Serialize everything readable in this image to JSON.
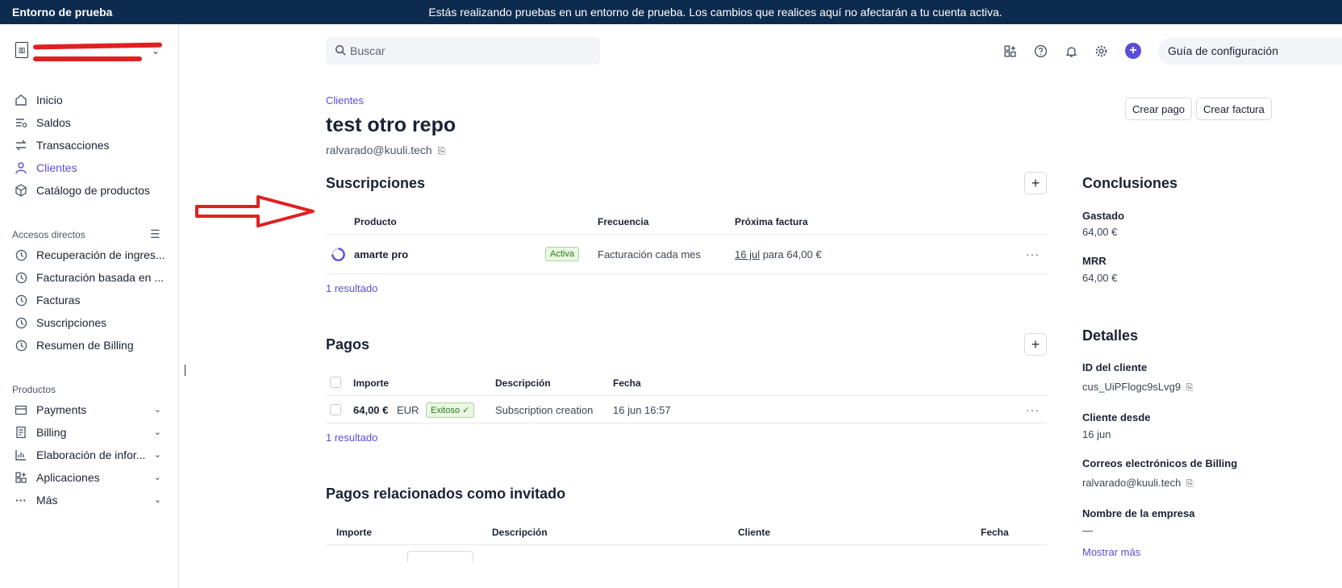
{
  "banner": {
    "env": "Entorno de prueba",
    "message": "Estás realizando pruebas en un entorno de prueba. Los cambios que realices aquí no afectarán a tu cuenta activa."
  },
  "sidebar": {
    "main": [
      {
        "label": "Inicio",
        "icon": "home-icon"
      },
      {
        "label": "Saldos",
        "icon": "balances-icon"
      },
      {
        "label": "Transacciones",
        "icon": "transactions-icon"
      },
      {
        "label": "Clientes",
        "icon": "customer-icon",
        "active": true
      },
      {
        "label": "Catálogo de productos",
        "icon": "box-icon"
      }
    ],
    "shortcuts_title": "Accesos directos",
    "shortcuts": [
      {
        "label": "Recuperación de ingres..."
      },
      {
        "label": "Facturación basada en ..."
      },
      {
        "label": "Facturas"
      },
      {
        "label": "Suscripciones"
      },
      {
        "label": "Resumen de Billing"
      }
    ],
    "products_title": "Productos",
    "products": [
      {
        "label": "Payments",
        "icon": "payments-icon"
      },
      {
        "label": "Billing",
        "icon": "billing-icon"
      },
      {
        "label": "Elaboración de infor...",
        "icon": "reports-icon"
      },
      {
        "label": "Aplicaciones",
        "icon": "apps-icon"
      },
      {
        "label": "Más",
        "icon": "more-icon"
      }
    ]
  },
  "search": {
    "placeholder": "Buscar"
  },
  "guide_label": "Guía de configuración",
  "header": {
    "breadcrumb": "Clientes",
    "title": "test otro repo",
    "email": "ralvarado@kuuli.tech",
    "create_payment": "Crear pago",
    "create_invoice": "Crear factura"
  },
  "subscriptions": {
    "title": "Suscripciones",
    "columns": [
      "Producto",
      "Frecuencia",
      "Próxima factura"
    ],
    "row": {
      "product": "amarte pro",
      "status": "Activa",
      "frequency": "Facturación cada mes",
      "next_date": "16 jul",
      "next_rest": "para 64,00 €"
    },
    "count": "1 resultado"
  },
  "payments": {
    "title": "Pagos",
    "columns": [
      "Importe",
      "Descripción",
      "Fecha"
    ],
    "row": {
      "amount": "64,00 €",
      "currency": "EUR",
      "status": "Exitoso ✓",
      "description": "Subscription creation",
      "date": "16 jun 16:57"
    },
    "count": "1 resultado"
  },
  "guest_payments": {
    "title": "Pagos relacionados como invitado",
    "columns": [
      "Importe",
      "Descripción",
      "Cliente",
      "Fecha"
    ]
  },
  "insights": {
    "title": "Conclusiones",
    "spent_label": "Gastado",
    "spent_value": "64,00 €",
    "mrr_label": "MRR",
    "mrr_value": "64,00 €"
  },
  "details": {
    "title": "Detalles",
    "id_label": "ID del cliente",
    "id_value": "cus_UiPFlogc9sLvg9",
    "since_label": "Cliente desde",
    "since_value": "16 jun",
    "billing_email_label": "Correos electrónicos de Billing",
    "billing_email_value": "ralvarado@kuuli.tech",
    "company_label": "Nombre de la empresa",
    "company_value": "—",
    "show_more": "Mostrar más"
  }
}
